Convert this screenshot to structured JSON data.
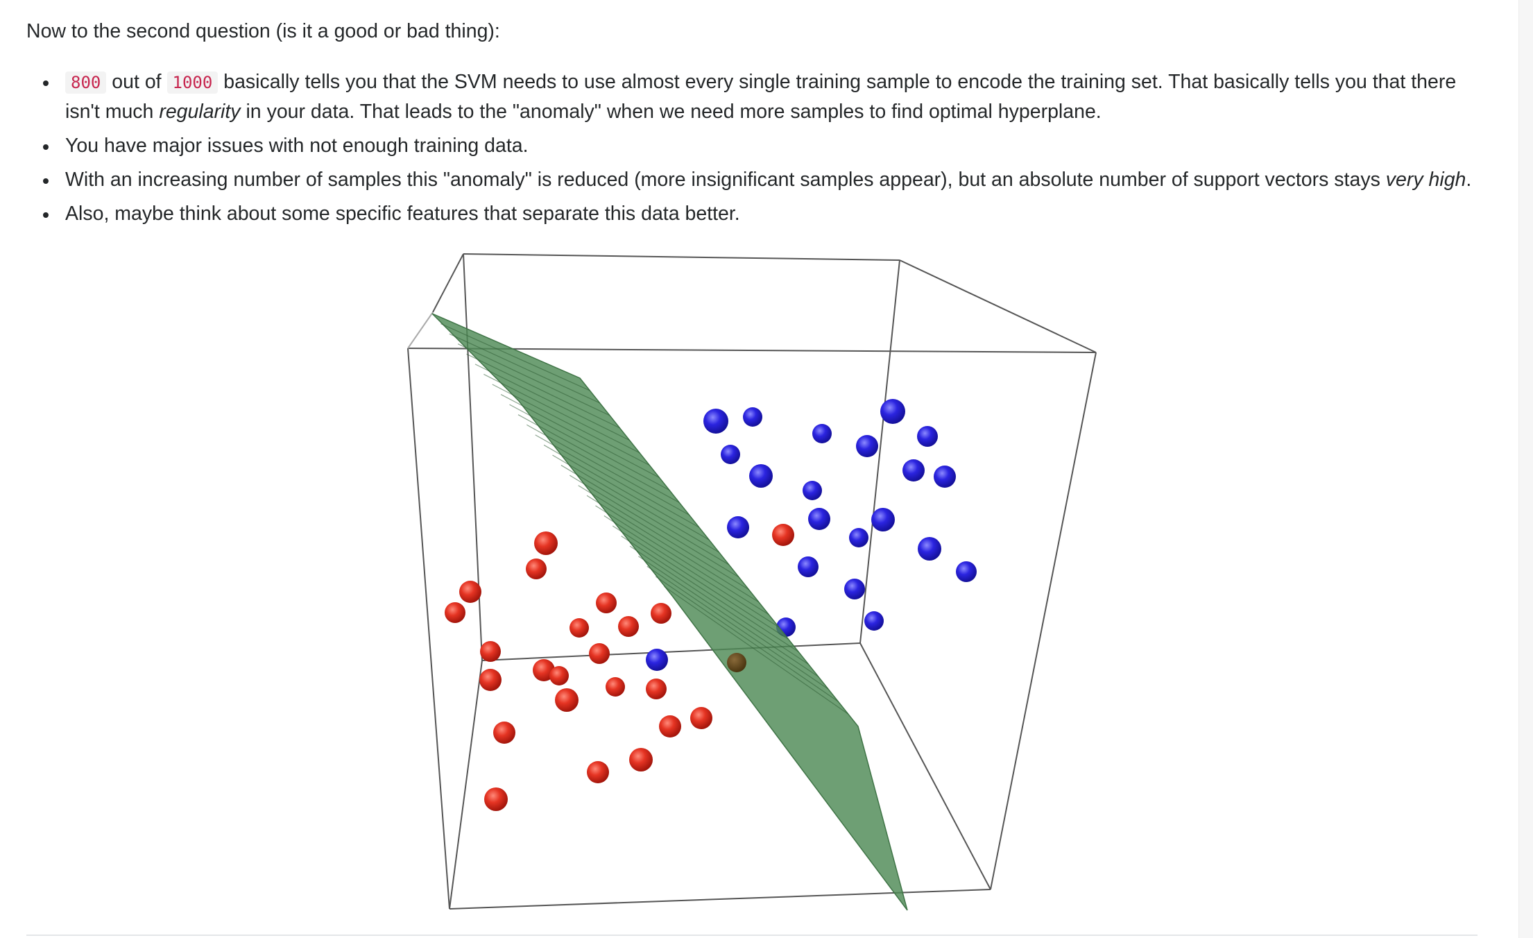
{
  "answer": {
    "intro": "Now to the second question (is it a good or bad thing):",
    "bullets": [
      {
        "code_a": "800",
        "text_a": " out of ",
        "code_b": "1000",
        "text_b": " basically tells you that the SVM needs to use almost every single training sample to encode the training set. That basically tells you that there isn't much ",
        "em": "regularity",
        "text_c": " in your data. That leads to the \"anomaly\" when we need more samples to find optimal hyperplane."
      },
      {
        "text": "You have major issues with not enough training data."
      },
      {
        "text_a": "With an increasing number of samples this \"anomaly\" is reduced (more insignificant samples appear), but an absolute number of support vectors stays ",
        "em": "very high",
        "text_b": "."
      },
      {
        "text": "Also, maybe think about some specific features that separate this data better."
      }
    ]
  },
  "figure": {
    "description_icon": "3d-scatter-plot-with-separating-hyperplane",
    "colors": {
      "class_red": "#e53423",
      "class_blue": "#2b24e0",
      "hyperplane": "#4e8a55",
      "box": "#555555"
    }
  }
}
